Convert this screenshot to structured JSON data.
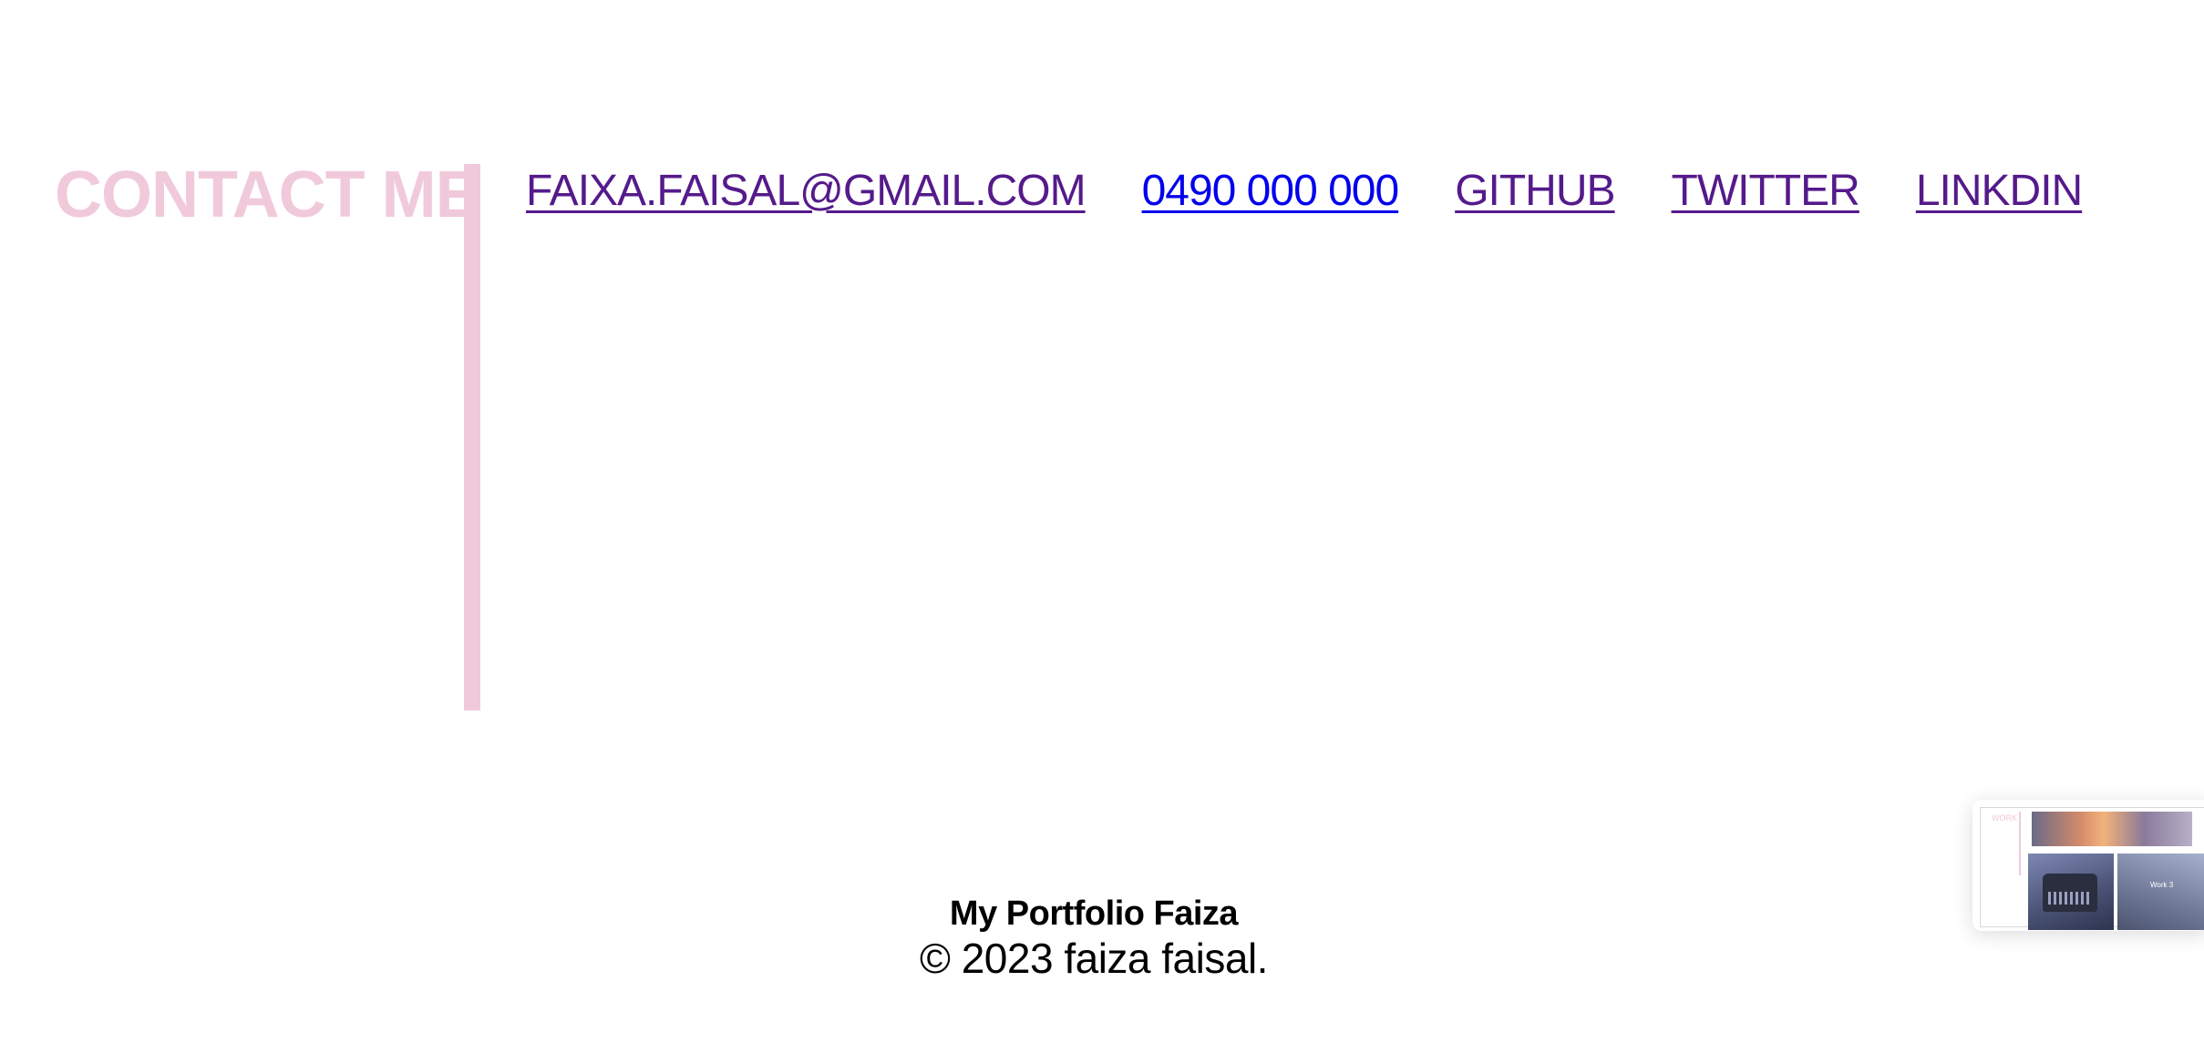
{
  "contact": {
    "heading": "CONTACT ME",
    "links": [
      {
        "label": "FAIXA.FAISAL@GMAIL.COM",
        "state": "visited"
      },
      {
        "label": "0490 000 000",
        "state": "unvisited"
      },
      {
        "label": "GITHUB",
        "state": "visited"
      },
      {
        "label": "TWITTER",
        "state": "visited"
      },
      {
        "label": "LINKDIN",
        "state": "visited"
      }
    ]
  },
  "footer": {
    "title": "My Portfolio Faiza",
    "copyright": "© 2023 faiza faisal."
  },
  "preview": {
    "label": "WORK",
    "image_caption": "Work 3"
  },
  "colors": {
    "accent_pink": "#f0cadb",
    "link_visited": "#551a8b",
    "link_unvisited": "#0000ee",
    "text": "#000000",
    "background": "#ffffff"
  }
}
